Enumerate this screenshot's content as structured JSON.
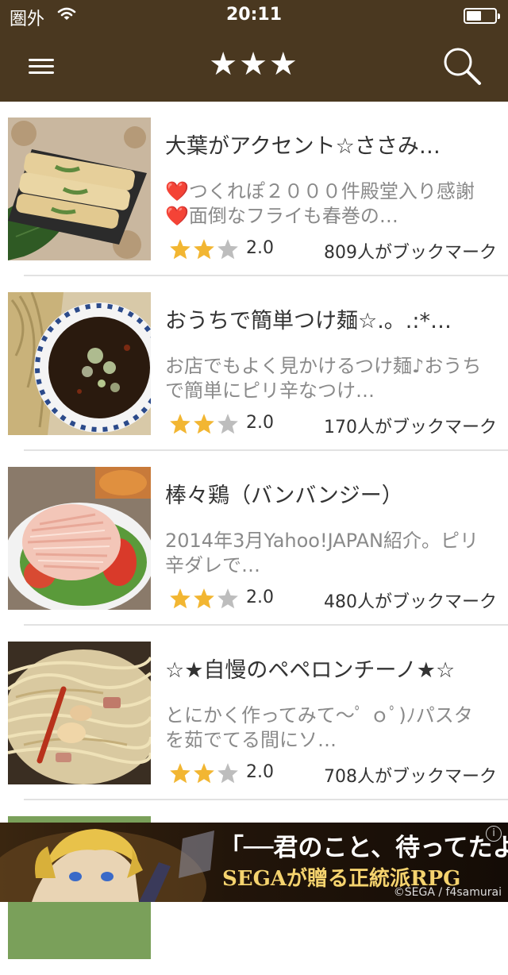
{
  "status_bar": {
    "carrier": "圏外",
    "time": "20:11"
  },
  "nav": {
    "title": "★★★",
    "menu_icon": "hamburger-menu-icon",
    "search_icon": "search-icon"
  },
  "recipes": [
    {
      "title": "大葉がアクセント☆ささみ…",
      "description": "❤️つくれぽ２０００件殿堂入り感謝❤️面倒なフライも春巻の…",
      "rating": "2.0",
      "rating_value": 2,
      "bookmarks": "809人がブックマーク"
    },
    {
      "title": "おうちで簡単つけ麺☆.。.:*…",
      "description": "お店でもよく見かけるつけ麺♪おうちで簡単にピリ辛なつけ…",
      "rating": "2.0",
      "rating_value": 2,
      "bookmarks": "170人がブックマーク"
    },
    {
      "title": "棒々鶏（バンバンジー）",
      "description": "2014年3月Yahoo!JAPAN紹介。ピリ辛ダレで…",
      "rating": "2.0",
      "rating_value": 2,
      "bookmarks": "480人がブックマーク"
    },
    {
      "title": "☆★自慢のペペロンチーノ★☆",
      "description": "とにかく作ってみて〜ﾟ ｏﾟ)ﾉパスタを茹でてる間にソ…",
      "rating": "2.0",
      "rating_value": 2,
      "bookmarks": "708人がブックマーク"
    }
  ],
  "ad": {
    "headline": "「──君のこと、待ってたよ!」",
    "subline": "SEGAが贈る正統派RPG",
    "copyright": "©SEGA / f4samurai",
    "info": "i"
  },
  "colors": {
    "nav_bg": "#4a3820",
    "star_on": "#f2b632",
    "star_off": "#bdbdbd"
  }
}
